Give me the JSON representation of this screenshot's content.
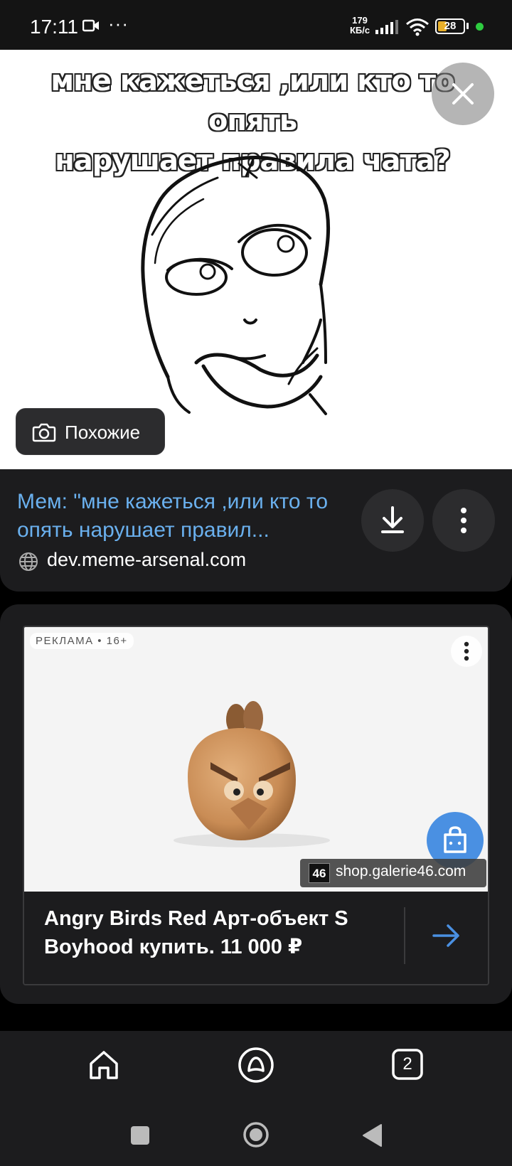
{
  "status_bar": {
    "time": "17:11",
    "speed_value": "179",
    "speed_unit": "КБ/с",
    "battery": "28",
    "icons": [
      "video-camera-icon",
      "more-dots-icon",
      "signal-icon",
      "wifi-icon",
      "battery-icon"
    ]
  },
  "meme": {
    "caption_line1": "мне кажеться ,или кто то опять",
    "caption_line2": "нарушает правила чата?",
    "similar_label": "Похожие"
  },
  "result": {
    "title": "Мем: \"мне кажеться ,или кто то опять нарушает правил...",
    "domain": "dev.meme-arsenal.com"
  },
  "ad": {
    "label": "РЕКЛАМА • 16+",
    "shop_logo": "46",
    "shop_domain": "shop.galerie46.com",
    "title": "Angry Birds Red Арт-объект S Boyhood купить. 11 000 ₽",
    "accent": "#4a90e2"
  },
  "bottom_nav": {
    "tabs_count": "2"
  }
}
